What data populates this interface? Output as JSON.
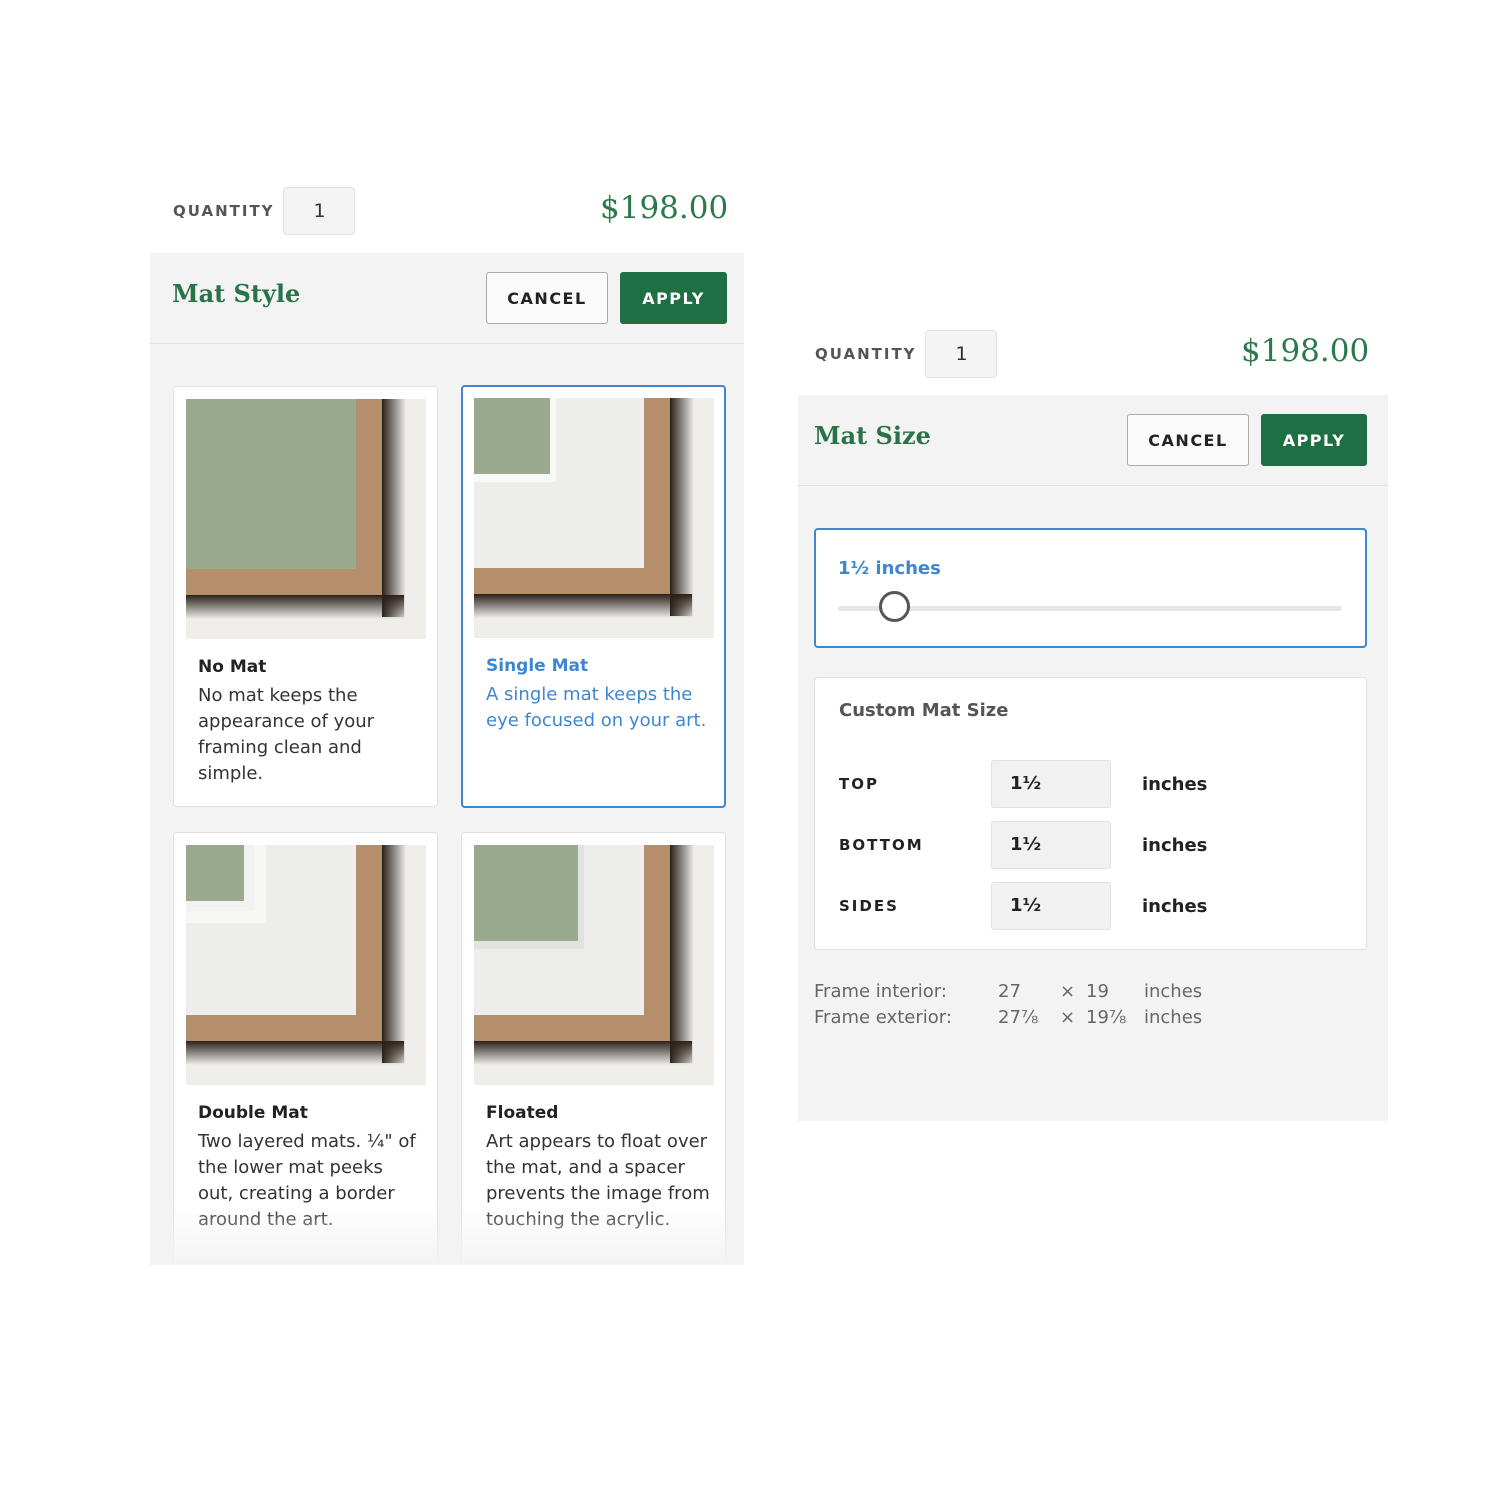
{
  "left": {
    "quantity": {
      "label": "QUANTITY",
      "value": "1"
    },
    "price": "$198.00",
    "panel": {
      "title": "Mat Style",
      "cancel_label": "CANCEL",
      "apply_label": "APPLY",
      "cards": [
        {
          "title": "No Mat",
          "description": "No mat keeps the appearance of your framing clean and simple.",
          "selected": false
        },
        {
          "title": "Single Mat",
          "description": "A single mat keeps the eye focused on your art.",
          "selected": true
        },
        {
          "title": "Double Mat",
          "description": "Two layered mats. ¼\" of the lower mat peeks out, creating a border around the art.",
          "selected": false
        },
        {
          "title": "Floated",
          "description": "Art appears to float over the mat, and a spacer prevents the image from touching the acrylic.",
          "selected": false
        }
      ]
    }
  },
  "right": {
    "quantity": {
      "label": "QUANTITY",
      "value": "1"
    },
    "price": "$198.00",
    "panel": {
      "title": "Mat Size",
      "cancel_label": "CANCEL",
      "apply_label": "APPLY",
      "slider": {
        "value_label": "1½ inches",
        "value_inches": 1.5
      },
      "custom": {
        "title": "Custom Mat Size",
        "rows": [
          {
            "label": "TOP",
            "value": "1½",
            "unit": "inches"
          },
          {
            "label": "BOTTOM",
            "value": "1½",
            "unit": "inches"
          },
          {
            "label": "SIDES",
            "value": "1½",
            "unit": "inches"
          }
        ]
      },
      "frame_info": {
        "interior": {
          "label": "Frame interior:",
          "width": "27",
          "times": "×",
          "height": "19",
          "unit": "inches"
        },
        "exterior": {
          "label": "Frame exterior:",
          "width": "27⅞",
          "times": "×",
          "height": "19⅞",
          "unit": "inches"
        }
      }
    }
  },
  "colors": {
    "brand_green": "#1f6f45",
    "price_green": "#2b7a4b",
    "selected_blue": "#3f86d0",
    "panel_bg": "#f3f3f3",
    "sage_art": "#9aaa8f",
    "frame_wood": "#b28f6c",
    "mat_white": "#eeeeec"
  }
}
